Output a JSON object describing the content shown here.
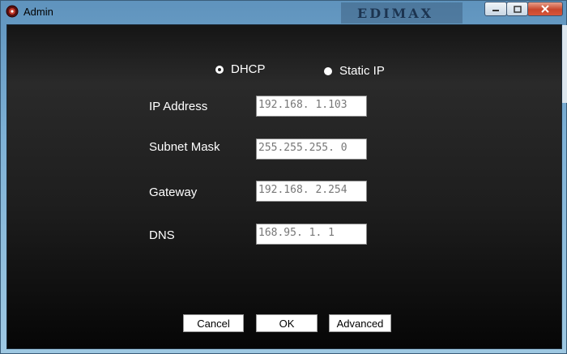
{
  "window": {
    "title": "Admin",
    "brand_logo": "EDIMAX"
  },
  "title_buttons": {
    "minimize": "minimize-icon",
    "maximize": "maximize-icon",
    "close": "close-icon"
  },
  "mode": {
    "dhcp_label": "DHCP",
    "static_label": "Static IP",
    "selected": "DHCP"
  },
  "fields": [
    {
      "label": "IP Address",
      "value": "192.168. 1.103"
    },
    {
      "label": "Subnet Mask",
      "value": "255.255.255. 0"
    },
    {
      "label": "Gateway",
      "value": "192.168. 2.254"
    },
    {
      "label": "DNS",
      "value": "168.95. 1. 1"
    }
  ],
  "buttons": {
    "cancel": "Cancel",
    "ok": "OK",
    "advanced": "Advanced"
  }
}
